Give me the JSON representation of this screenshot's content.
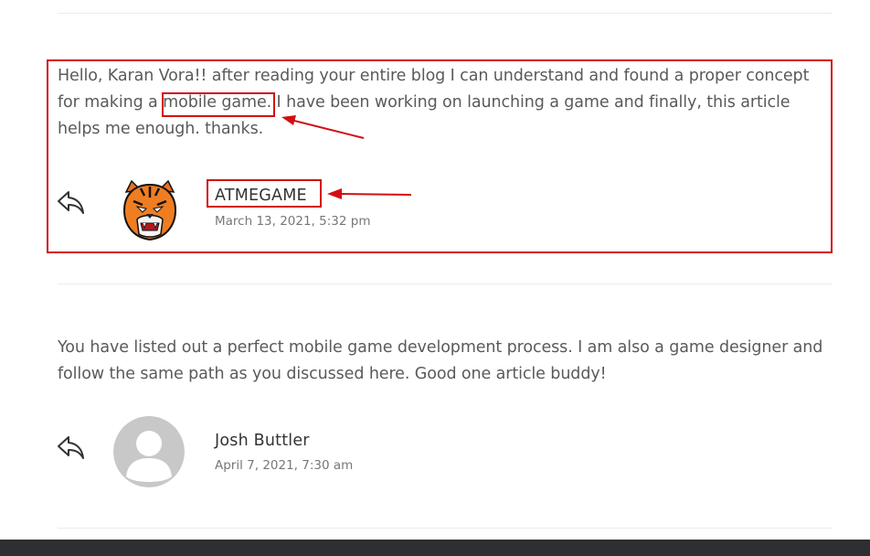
{
  "comments": [
    {
      "text_before": "Hello, Karan Vora!! after reading your entire blog I can understand and found a proper concept for making a ",
      "text_highlight": "mobile game.",
      "text_after": " I have been working on launching a game and finally, this article helps me enough. thanks.",
      "author": "ATMEGAME",
      "date": "March 13, 2021, 5:32 pm",
      "avatar_icon": "tiger-logo-icon"
    },
    {
      "text": "You have listed out a perfect mobile game development process. I am also a game designer and follow the same path as you discussed here. Good one article buddy!",
      "author": "Josh Buttler",
      "date": "April 7, 2021, 7:30 am",
      "avatar_icon": "default-user-icon"
    }
  ],
  "colors": {
    "annotation": "#d10f14",
    "text": "#5a5a5a",
    "author": "#333333",
    "date": "#777777",
    "footer": "#2e2f31"
  }
}
